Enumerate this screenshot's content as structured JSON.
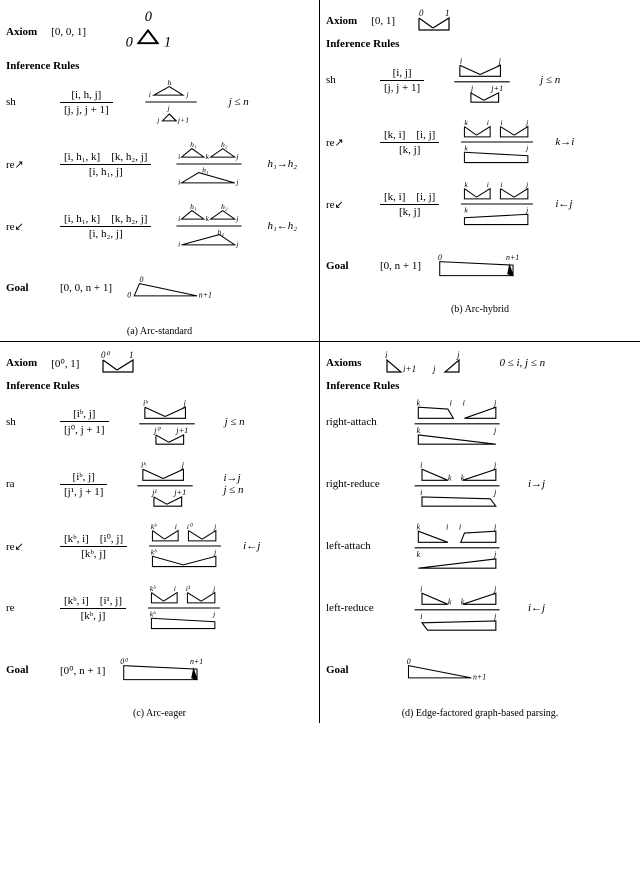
{
  "panels": {
    "a": {
      "caption": "(a) Arc-standard",
      "axiom_label": "Axiom",
      "axiom_item": "[0, 0, 1]",
      "rules_label": "Inference Rules",
      "goal_label": "Goal",
      "goal_item": "[0, 0, n + 1]",
      "rules": {
        "sh": {
          "name": "sh",
          "num": "[i, h, j]",
          "den": "[j, j, j + 1]",
          "cond": "j ≤ n"
        },
        "reR": {
          "name": "re↗",
          "num": "[i, h₁, k] [k, h₂, j]",
          "den": "[i, h₁, j]",
          "cond": "h₁→h₂"
        },
        "reL": {
          "name": "re↙",
          "num": "[i, h₁, k] [k, h₂, j]",
          "den": "[i, h₂, j]",
          "cond": "h₁←h₂"
        }
      }
    },
    "b": {
      "caption": "(b) Arc-hybrid",
      "axiom_label": "Axiom",
      "axiom_item": "[0, 1]",
      "rules_label": "Inference Rules",
      "goal_label": "Goal",
      "goal_item": "[0, n + 1]",
      "rules": {
        "sh": {
          "name": "sh",
          "num": "[i, j]",
          "den": "[j, j + 1]",
          "cond": "j ≤ n"
        },
        "reR": {
          "name": "re↗",
          "num": "[k, i] [i, j]",
          "den": "[k, j]",
          "cond": "k→i"
        },
        "reL": {
          "name": "re↙",
          "num": "[k, i] [i, j]",
          "den": "[k, j]",
          "cond": "i←j"
        }
      }
    },
    "c": {
      "caption": "(c) Arc-eager",
      "axiom_label": "Axiom",
      "axiom_item": "[0⁰, 1]",
      "rules_label": "Inference Rules",
      "goal_label": "Goal",
      "goal_item": "[0⁰, n + 1]",
      "rules": {
        "sh": {
          "name": "sh",
          "num": "[iᵇ, j]",
          "den": "[j⁰, j + 1]",
          "cond": "j ≤ n"
        },
        "ra": {
          "name": "ra",
          "num": "[iᵇ, j]",
          "den": "[j¹, j + 1]",
          "cond": "i→j\nj ≤ n"
        },
        "reL": {
          "name": "re↙",
          "num": "[kᵇ, i] [i⁰, j]",
          "den": "[kᵇ, j]",
          "cond": "i←j"
        },
        "re": {
          "name": "re",
          "num": "[kᵇ, i] [i¹, j]",
          "den": "[kᵇ, j]",
          "cond": ""
        }
      }
    },
    "d": {
      "caption": "(d) Edge-factored graph-based parsing.",
      "axiom_label": "Axioms",
      "axiom_item": "0 ≤ i, j ≤ n",
      "rules_label": "Inference Rules",
      "goal_label": "Goal",
      "goal_item": "",
      "rules": {
        "rA": {
          "name": "right-attach",
          "cond": ""
        },
        "rR": {
          "name": "right-reduce",
          "cond": "i→j"
        },
        "lA": {
          "name": "left-attach",
          "cond": ""
        },
        "lR": {
          "name": "left-reduce",
          "cond": "i←j"
        }
      }
    }
  },
  "chart_data": {
    "type": "table",
    "description": "Deductive system figures for four parsing algorithms (Arc-standard, Arc-hybrid, Arc-eager, Edge-factored). Each panel lists an Axiom item, named Inference Rules written as premises over a line over conclusion with side-condition, and a Goal item. Triangle/trapezoid diagrams next to each rule are schematic span pictures with endpoint labels i, j, k, h, h1, h2, 0, n+1.",
    "panels": [
      {
        "id": "a",
        "title": "Arc-standard",
        "axiom": "[0,0,1]",
        "goal": "[0,0,n+1]",
        "rules": [
          {
            "name": "sh",
            "premises": [
              "[i,h,j]"
            ],
            "conclusion": "[j,j,j+1]",
            "cond": "j<=n"
          },
          {
            "name": "re→",
            "premises": [
              "[i,h1,k]",
              "[k,h2,j]"
            ],
            "conclusion": "[i,h1,j]",
            "cond": "h1→h2"
          },
          {
            "name": "re←",
            "premises": [
              "[i,h1,k]",
              "[k,h2,j]"
            ],
            "conclusion": "[i,h2,j]",
            "cond": "h1←h2"
          }
        ]
      },
      {
        "id": "b",
        "title": "Arc-hybrid",
        "axiom": "[0,1]",
        "goal": "[0,n+1]",
        "rules": [
          {
            "name": "sh",
            "premises": [
              "[i,j]"
            ],
            "conclusion": "[j,j+1]",
            "cond": "j<=n"
          },
          {
            "name": "re→",
            "premises": [
              "[k,i]",
              "[i,j]"
            ],
            "conclusion": "[k,j]",
            "cond": "k→i"
          },
          {
            "name": "re←",
            "premises": [
              "[k,i]",
              "[i,j]"
            ],
            "conclusion": "[k,j]",
            "cond": "i←j"
          }
        ]
      },
      {
        "id": "c",
        "title": "Arc-eager",
        "axiom": "[0^0,1]",
        "goal": "[0^0,n+1]",
        "rules": [
          {
            "name": "sh",
            "premises": [
              "[i^b,j]"
            ],
            "conclusion": "[j^0,j+1]",
            "cond": "j<=n"
          },
          {
            "name": "ra",
            "premises": [
              "[i^b,j]"
            ],
            "conclusion": "[j^1,j+1]",
            "cond": "i→j, j<=n"
          },
          {
            "name": "re←",
            "premises": [
              "[k^b,i]",
              "[i^0,j]"
            ],
            "conclusion": "[k^b,j]",
            "cond": "i←j"
          },
          {
            "name": "re",
            "premises": [
              "[k^b,i]",
              "[i^1,j]"
            ],
            "conclusion": "[k^b,j]",
            "cond": ""
          }
        ]
      },
      {
        "id": "d",
        "title": "Edge-factored graph-based parsing",
        "axioms": "two half-triangles at (i,i+1) and (j-? , j), 0<=i,j<=n",
        "goal": "closed right-triangle [0, n+1]",
        "rules": [
          {
            "name": "right-attach",
            "premises": [
              "left trapezoid k..i",
              "right half-tri i..j"
            ],
            "conclusion": "trapezoid k..j"
          },
          {
            "name": "right-reduce",
            "premises": [
              "half-tri i..k",
              "half-tri k..j"
            ],
            "conclusion": "trapezoid i..j",
            "cond": "i→j"
          },
          {
            "name": "left-attach",
            "premises": [
              "half-tri k..i",
              "left trapezoid i..j"
            ],
            "conclusion": "trapezoid k..j"
          },
          {
            "name": "left-reduce",
            "premises": [
              "half-tri i..k",
              "half-tri k..j"
            ],
            "conclusion": "trapezoid i..j",
            "cond": "i←j"
          }
        ]
      }
    ]
  }
}
